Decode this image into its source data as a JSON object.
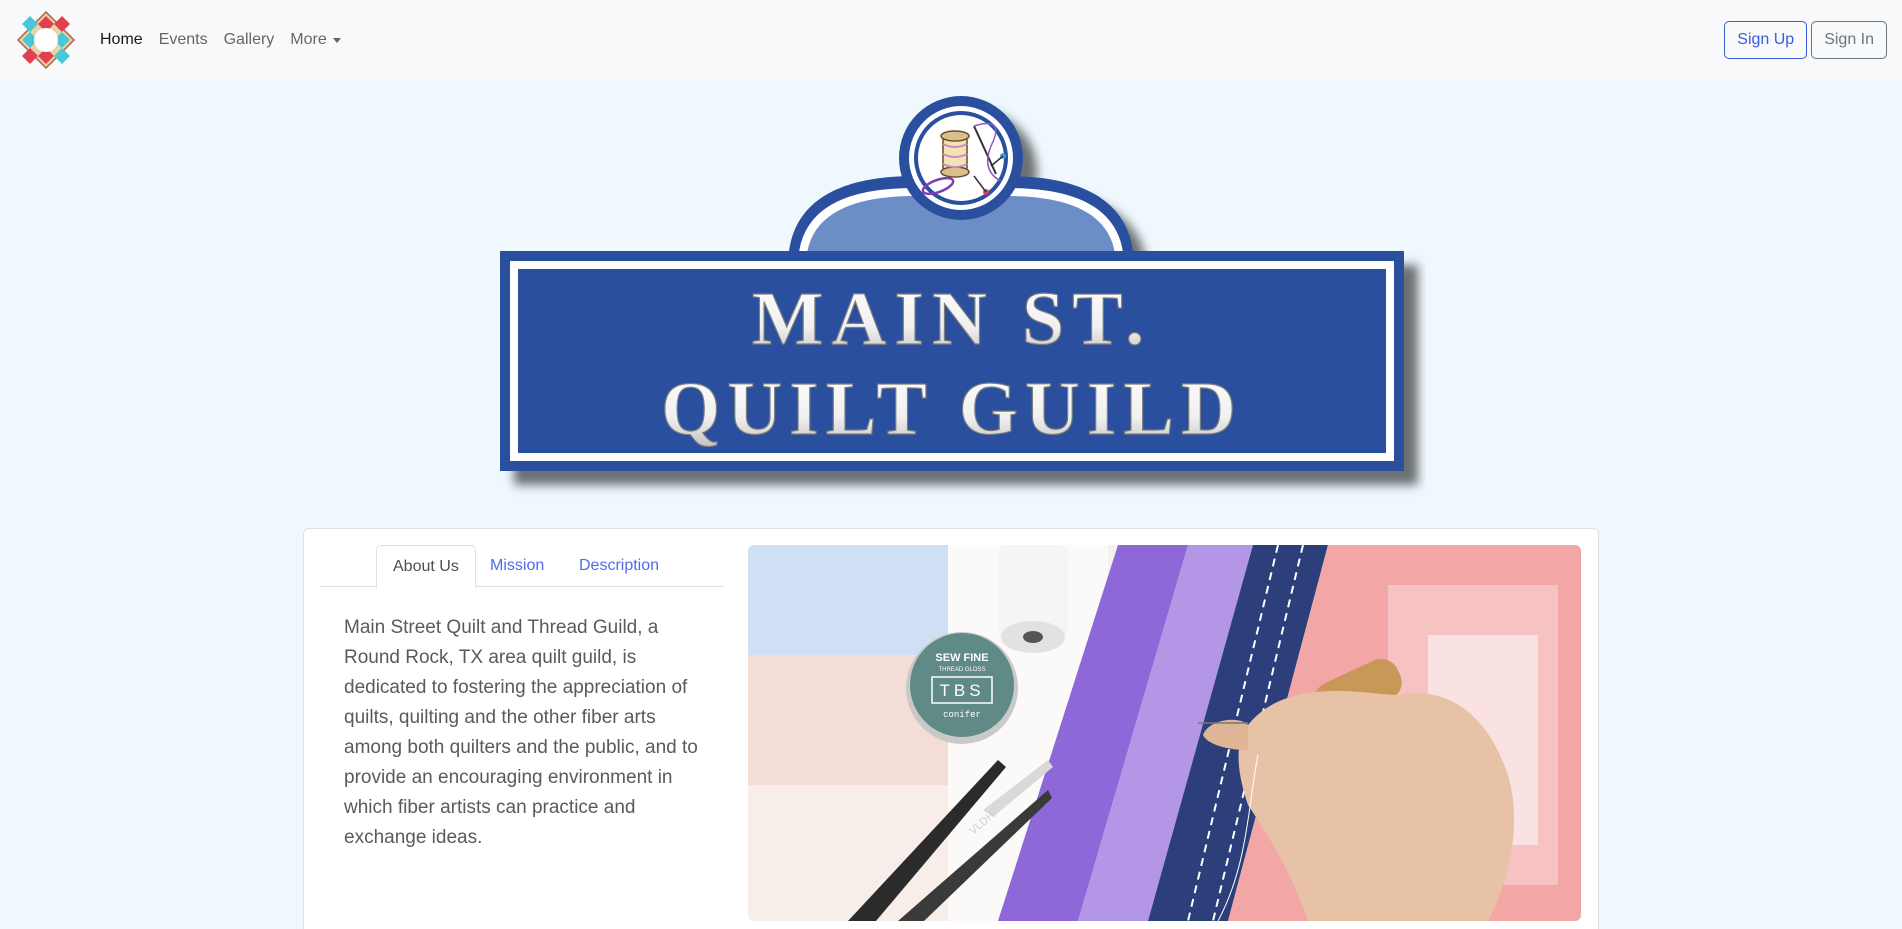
{
  "nav": {
    "brand_icon": "quilt-block-logo",
    "links": [
      {
        "label": "Home",
        "active": true
      },
      {
        "label": "Events",
        "active": false
      },
      {
        "label": "Gallery",
        "active": false
      },
      {
        "label": "More",
        "active": false,
        "dropdown": true
      }
    ],
    "sign_up": "Sign Up",
    "sign_in": "Sign In"
  },
  "logo": {
    "line1": "MAIN ST.",
    "line2": "QUILT GUILD",
    "emblem_icon": "spool-needle-icon"
  },
  "about": {
    "tabs": [
      "About Us",
      "Mission",
      "Description"
    ],
    "active_tab": "About Us",
    "text": "Main Street Quilt and Thread Guild, a Round Rock, TX area quilt guild, is dedicated to fostering the appreciation of quilts, quilting and the other fiber arts among both quilters and the public, and to provide an encouraging environment in which fiber artists can practice and exchange ideas."
  },
  "photo": {
    "tin_brand": "SEW FINE",
    "tin_sub": "THREAD GLOSS",
    "tin_logo": "TBS",
    "tin_flavor": "conifer",
    "snips_mark": "VLDH"
  },
  "colors": {
    "brand_blue": "#2a4f9e",
    "light_blue": "#6c8ec6",
    "page_bg": "#eef8fd",
    "link_blue": "#4f6bed"
  }
}
